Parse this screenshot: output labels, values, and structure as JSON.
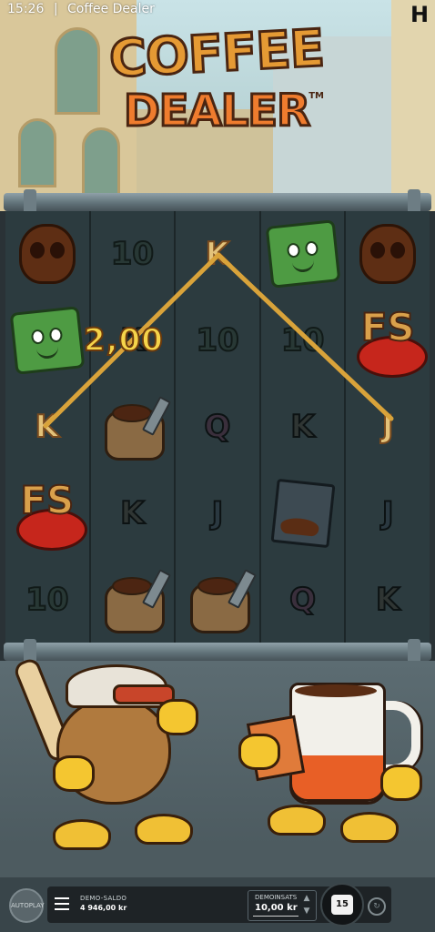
{
  "status_bar": {
    "time": "15:26",
    "separator": "|",
    "app_title": "Coffee Dealer"
  },
  "publisher_logo": {
    "icon": "hacksaw-h-logo"
  },
  "game_logo": {
    "line1": "COFFEE",
    "line2": "DEALER",
    "trademark": "TM"
  },
  "reels": [
    [
      "skull",
      "cash",
      "K",
      "FS",
      "10"
    ],
    [
      "10",
      "K",
      "sack",
      "K",
      "sack"
    ],
    [
      "K",
      "10",
      "Q",
      "J",
      "sack"
    ],
    [
      "cash",
      "10",
      "K",
      "pouch",
      "Q"
    ],
    [
      "skull",
      "FS",
      "J",
      "J",
      "K"
    ]
  ],
  "win": {
    "amount": "2,00",
    "line_color": "#d9a33a"
  },
  "bottom_bar": {
    "autoplay_label": "AUTOPLAY",
    "menu_icon": "hamburger-menu-icon",
    "balance_label": "DEMO-SALDO",
    "balance_value": "4 946,00 kr",
    "bet_label": "DEMOINSATS",
    "bet_value": "10,00 kr",
    "spin_value": "15",
    "turbo_icon": "turbo-icon"
  },
  "colors": {
    "accent": "#e59a34",
    "frame": "#5e6f76",
    "win_text": "#f5d44a"
  }
}
